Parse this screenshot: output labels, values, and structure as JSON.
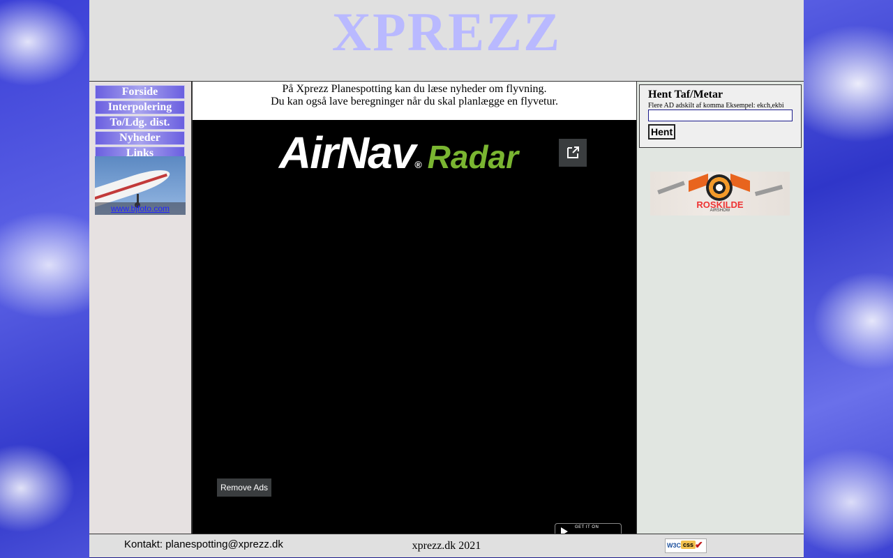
{
  "header": {
    "title": "XPREZZ"
  },
  "menu": {
    "items": [
      {
        "label": "Forside"
      },
      {
        "label": "Interpolering"
      },
      {
        "label": "To/Ldg. dist."
      },
      {
        "label": "Nyheder"
      },
      {
        "label": "Links"
      }
    ]
  },
  "sidebar": {
    "photo_link": "www.bjfoto.com"
  },
  "intro": {
    "line1": "På Xprezz Planespotting kan du læse nyheder om flyvning.",
    "line2": "Du kan også lave beregninger når du skal planlægge en flyvetur."
  },
  "radar": {
    "brand_main": "AirNav",
    "brand_reg": "®",
    "brand_sub": "Radar",
    "remove_ads": "Remove Ads",
    "play_small": "GET IT ON",
    "brand_color": "#7ab531"
  },
  "metar": {
    "title": "Hent Taf/Metar",
    "hint": "Flere AD adskilt af komma Eksempel: ekch,ekbi",
    "input_value": "",
    "button": "Hent"
  },
  "banner": {
    "name": "ROSKILDE",
    "sub": "AIRSHOW"
  },
  "footer": {
    "contact": "Kontakt: planespotting@xprezz.dk",
    "copyright": "xprezz.dk 2021",
    "badge_w3c": "W3C",
    "badge_css": "css"
  },
  "colors": {
    "title": "#b9b9ff",
    "menu": "#6a5fe0",
    "link": "#2323ff"
  }
}
